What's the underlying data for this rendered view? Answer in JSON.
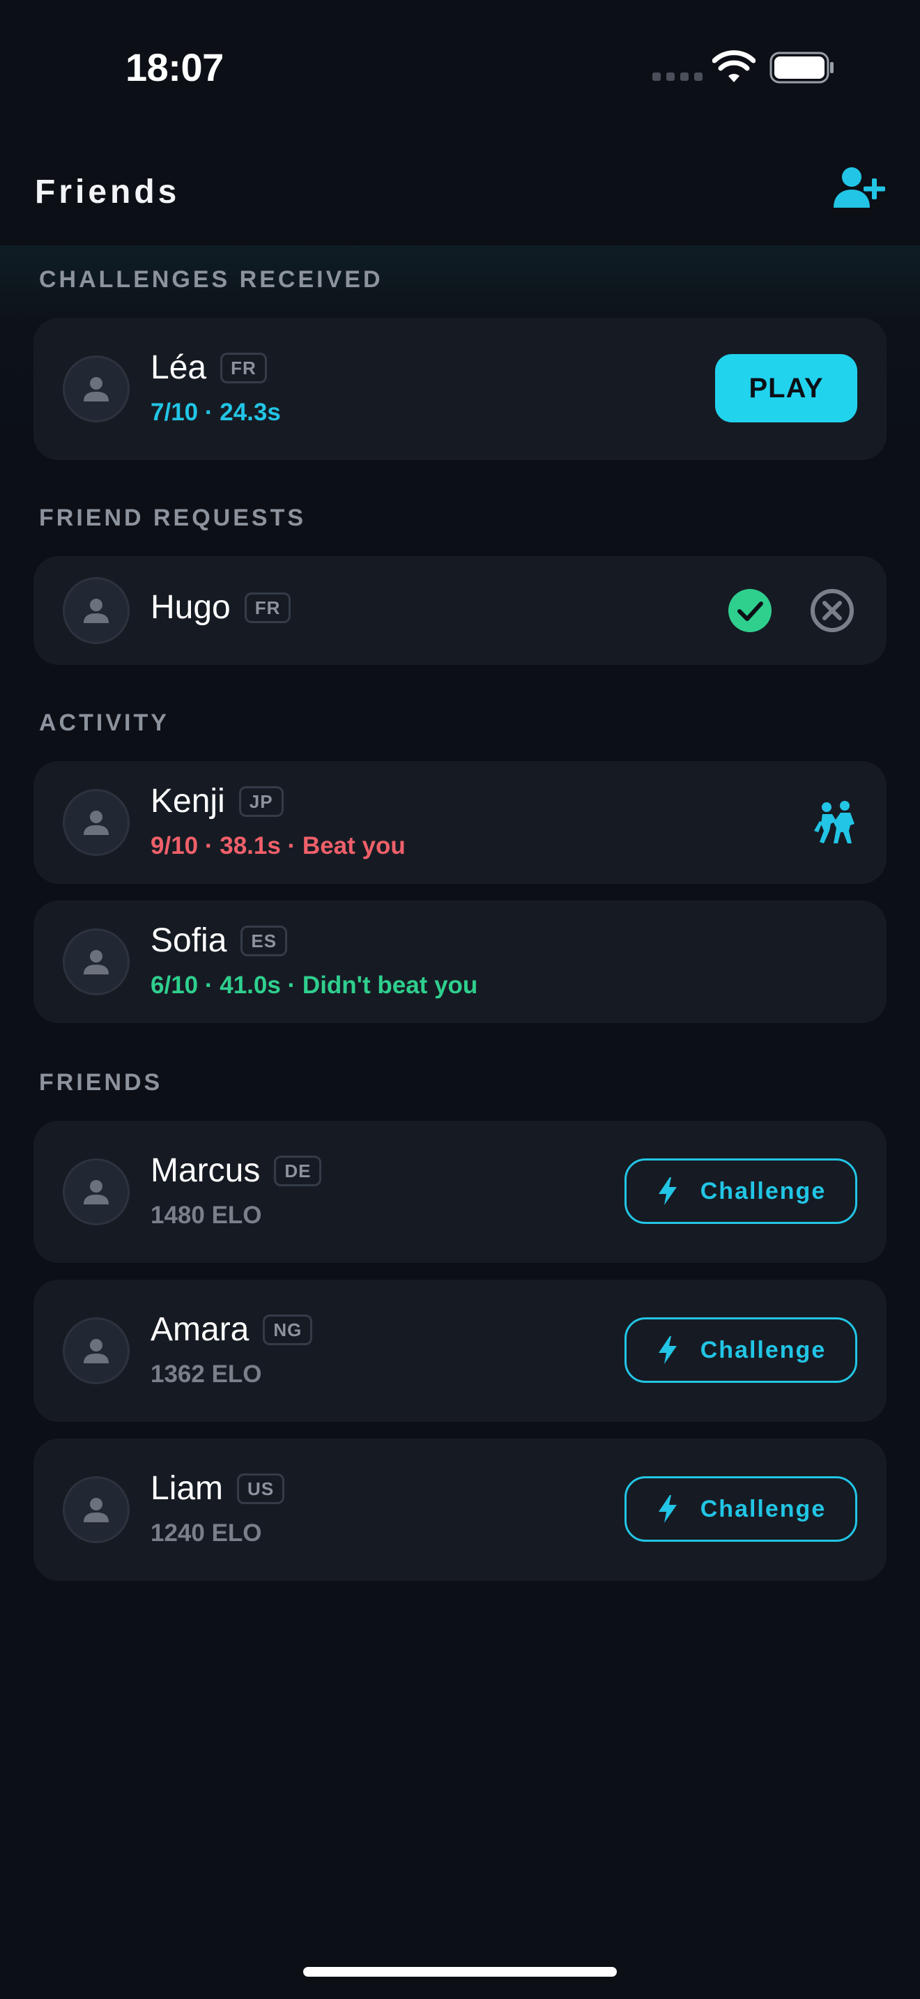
{
  "status_bar": {
    "time": "18:07"
  },
  "header": {
    "title": "Friends",
    "add_friend_icon": "person-add-icon"
  },
  "sections": {
    "challenges_received": "CHALLENGES RECEIVED",
    "friend_requests": "FRIEND REQUESTS",
    "activity": "ACTIVITY",
    "friends": "FRIENDS"
  },
  "challenges": [
    {
      "name": "Léa",
      "country": "FR",
      "result": "7/10 · 24.3s",
      "action": "PLAY"
    }
  ],
  "requests": [
    {
      "name": "Hugo",
      "country": "FR",
      "accept_icon": "check-circle-icon",
      "decline_icon": "x-circle-icon"
    }
  ],
  "activity": [
    {
      "name": "Kenji",
      "country": "JP",
      "result": "9/10 · 38.1s · Beat you",
      "status_color": "#f0606a",
      "icon": "rematch-icon"
    },
    {
      "name": "Sofia",
      "country": "ES",
      "result": "6/10 · 41.0s · Didn't beat you",
      "status_color": "#2fcf8e"
    }
  ],
  "friends": [
    {
      "name": "Marcus",
      "country": "DE",
      "elo": "1480 ELO",
      "action": "Challenge"
    },
    {
      "name": "Amara",
      "country": "NG",
      "elo": "1362 ELO",
      "action": "Challenge"
    },
    {
      "name": "Liam",
      "country": "US",
      "elo": "1240 ELO",
      "action": "Challenge"
    }
  ],
  "colors": {
    "accent": "#22d3ee",
    "background": "#0c0f16",
    "card": "#161b23",
    "loss": "#f0606a",
    "win": "#2fcf8e"
  }
}
